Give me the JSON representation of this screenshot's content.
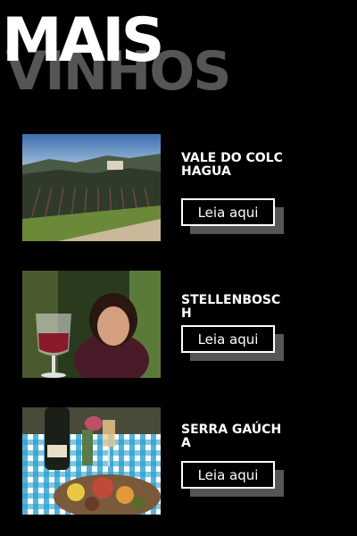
{
  "header": {
    "front_text": "MAIS",
    "back_text": "VINHOS"
  },
  "colors": {
    "background": "#000000",
    "text": "#ffffff",
    "shadow_gray": "#555555"
  },
  "cards": [
    {
      "title": "VALE DO COLCHAGUA",
      "button_label": "Leia aqui",
      "image": "vineyard-landscape"
    },
    {
      "title": "STELLENBOSCH",
      "button_label": "Leia aqui",
      "image": "woman-with-wine-glass"
    },
    {
      "title": "SERRA GAÚCHA",
      "button_label": "Leia aqui",
      "image": "picnic-wine-table"
    }
  ]
}
